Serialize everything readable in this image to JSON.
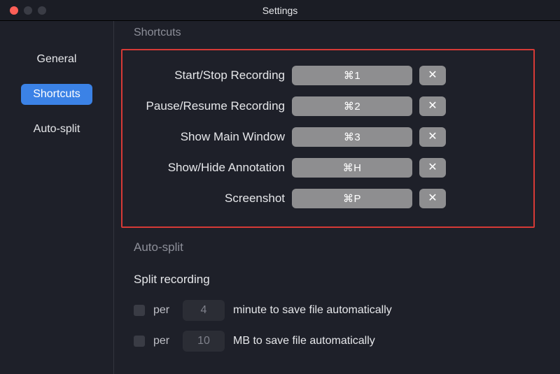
{
  "window": {
    "title": "Settings"
  },
  "sidebar": {
    "items": [
      {
        "label": "General"
      },
      {
        "label": "Shortcuts"
      },
      {
        "label": "Auto-split"
      }
    ]
  },
  "shortcuts": {
    "heading": "Shortcuts",
    "rows": [
      {
        "label": "Start/Stop Recording",
        "key": "⌘1"
      },
      {
        "label": "Pause/Resume Recording",
        "key": "⌘2"
      },
      {
        "label": "Show Main Window",
        "key": "⌘3"
      },
      {
        "label": "Show/Hide Annotation",
        "key": "⌘H"
      },
      {
        "label": "Screenshot",
        "key": "⌘P"
      }
    ],
    "clear_glyph": "✕"
  },
  "autosplit": {
    "heading": "Auto-split",
    "subheading": "Split recording",
    "per_label": "per",
    "rows": [
      {
        "value": "4",
        "suffix": "minute to save file automatically"
      },
      {
        "value": "10",
        "suffix": "MB to save file automatically"
      }
    ]
  }
}
